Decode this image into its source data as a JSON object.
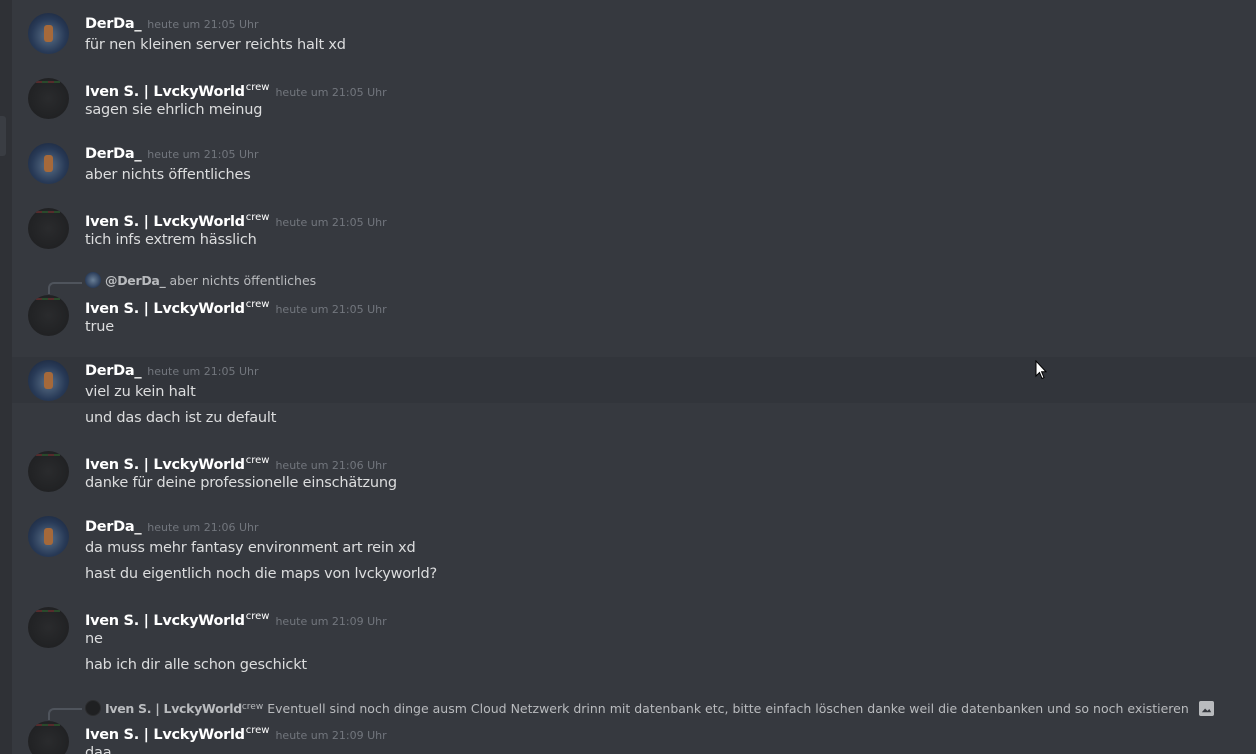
{
  "users": {
    "derda": {
      "name": "DerDa_"
    },
    "iven": {
      "name": "Iven S. | LvckyWorld",
      "tag": "crew"
    }
  },
  "messages": [
    {
      "author": "DerDa_",
      "time": "heute um 21:05 Uhr",
      "lines": [
        "für nen kleinen server reichts halt xd"
      ]
    },
    {
      "author": "Iven S. | LvckyWorld",
      "tag": "crew",
      "time": "heute um 21:05 Uhr",
      "lines": [
        "sagen sie ehrlich meinug"
      ]
    },
    {
      "author": "DerDa_",
      "time": "heute um 21:05 Uhr",
      "lines": [
        "aber nichts öffentliches"
      ]
    },
    {
      "author": "Iven S. | LvckyWorld",
      "tag": "crew",
      "time": "heute um 21:05 Uhr",
      "lines": [
        "tich infs extrem hässlich"
      ]
    },
    {
      "reply": {
        "author": "@DerDa_",
        "text": "aber nichts öffentliches"
      },
      "author": "Iven S. | LvckyWorld",
      "tag": "crew",
      "time": "heute um 21:05 Uhr",
      "lines": [
        "true"
      ]
    },
    {
      "author": "DerDa_",
      "time": "heute um 21:05 Uhr",
      "lines": [
        "viel zu kein halt",
        "und das dach ist zu default"
      ]
    },
    {
      "author": "Iven S. | LvckyWorld",
      "tag": "crew",
      "time": "heute um 21:06 Uhr",
      "lines": [
        "danke für deine professionelle einschätzung"
      ]
    },
    {
      "author": "DerDa_",
      "time": "heute um 21:06 Uhr",
      "lines": [
        "da muss mehr fantasy environment art rein xd",
        "hast du eigentlich noch die maps von lvckyworld?"
      ]
    },
    {
      "author": "Iven S. | LvckyWorld",
      "tag": "crew",
      "time": "heute um 21:09 Uhr",
      "lines": [
        "ne",
        "hab ich dir alle schon geschickt"
      ]
    },
    {
      "reply": {
        "author": "Iven S. | LvckyWorld",
        "tag": "crew",
        "text": "Eventuell sind noch dinge ausm Cloud Netzwerk drinn mit datenbank etc, bitte einfach löschen danke weil die datenbanken und so noch existieren"
      },
      "author": "Iven S. | LvckyWorld",
      "tag": "crew",
      "time": "heute um 21:09 Uhr",
      "lines": [
        "daa"
      ]
    }
  ],
  "icons": {
    "reply_attachment": "image-icon",
    "cursor": "mouse-pointer-icon"
  },
  "colors": {
    "background": "#36393f",
    "username": "#ffffff",
    "text": "#dcddde",
    "timestamp": "#72767d",
    "reply_text": "#b9bbbe"
  }
}
